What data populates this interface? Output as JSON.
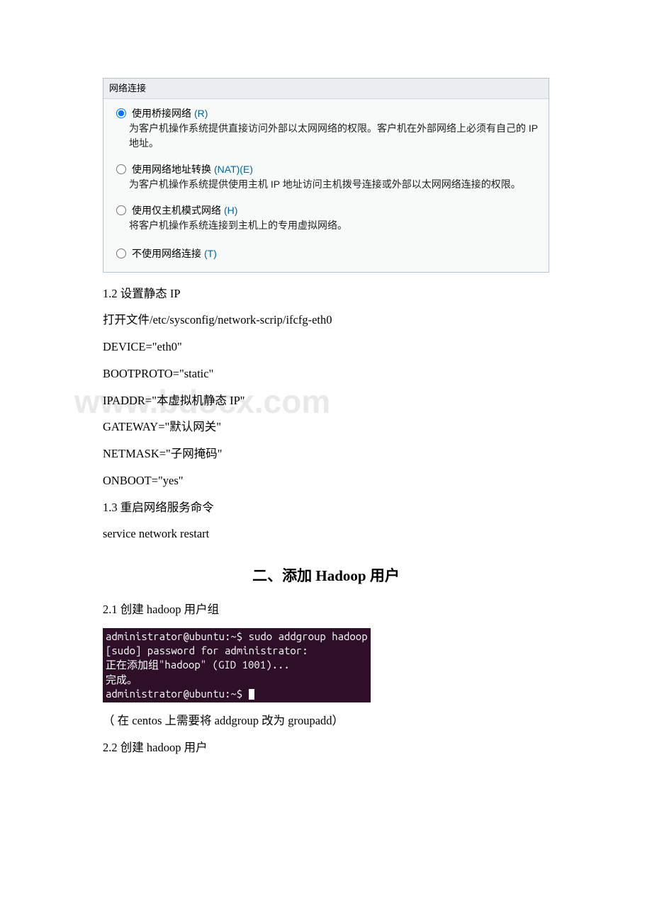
{
  "panel": {
    "title": "网络连接",
    "options": {
      "bridged": {
        "label_pre": "使用桥接网络",
        "letter": "(R)",
        "desc": "为客户机操作系统提供直接访问外部以太网网络的权限。客户机在外部网络上必须有自己的 IP 地址。"
      },
      "nat": {
        "label_pre": "使用网络地址转换",
        "letter": "(NAT)(E)",
        "desc": "为客户机操作系统提供使用主机 IP 地址访问主机拨号连接或外部以太网网络连接的权限。"
      },
      "hostonly": {
        "label_pre": "使用仅主机模式网络",
        "letter": "(H)",
        "desc": "将客户机操作系统连接到主机上的专用虚拟网络。"
      },
      "none": {
        "label_pre": "不使用网络连接",
        "letter": "(T)"
      }
    }
  },
  "section12": {
    "heading": "1.2 设置静态 IP",
    "line1": "打开文件/etc/sysconfig/network-scrip/ifcfg-eth0",
    "device": "DEVICE=\"eth0\"",
    "bootproto": "BOOTPROTO=\"static\"",
    "ipaddr": "IPADDR=\"本虚拟机静态 IP\"",
    "gateway": "GATEWAY=\"默认网关\"",
    "netmask": "NETMASK=\"子网掩码\"",
    "onboot": "ONBOOT=\"yes\""
  },
  "section13": {
    "heading": "1.3 重启网络服务命令",
    "command": "service network restart"
  },
  "section2": {
    "heading": "二、添加 Hadoop 用户",
    "sub21": "2.1 创建 hadoop 用户组",
    "terminal": "administrator@ubuntu:~$ sudo addgroup hadoop\n[sudo] password for administrator:\n正在添加组\"hadoop\" (GID 1001)...\n完成。\nadministrator@ubuntu:~$ ",
    "note": "（ 在 centos 上需要将 addgroup 改为 groupadd）",
    "sub22": "2.2 创建 hadoop 用户"
  },
  "watermark": "www.bdocx.com"
}
